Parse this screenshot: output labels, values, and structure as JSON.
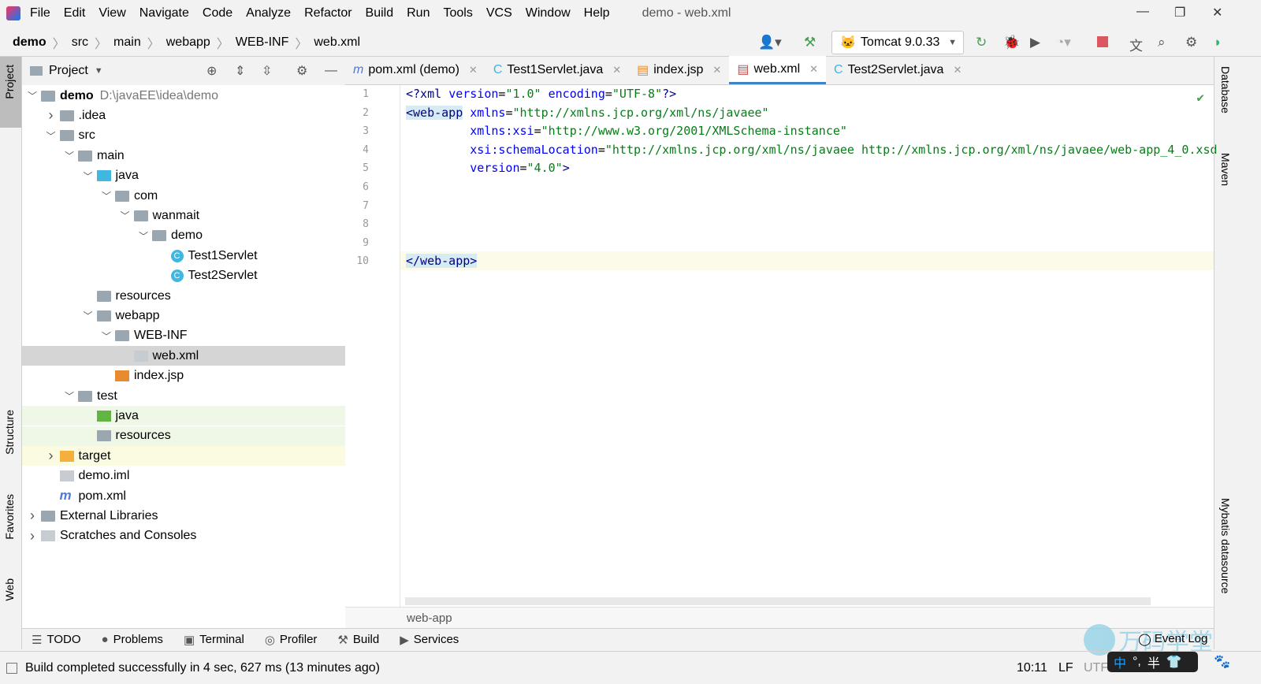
{
  "menu": {
    "items": [
      "File",
      "Edit",
      "View",
      "Navigate",
      "Code",
      "Analyze",
      "Refactor",
      "Build",
      "Run",
      "Tools",
      "VCS",
      "Window",
      "Help"
    ],
    "title": "demo - web.xml"
  },
  "breadcrumb": [
    "demo",
    "src",
    "main",
    "webapp",
    "WEB-INF",
    "web.xml"
  ],
  "toolbar": {
    "run_config": "Tomcat 9.0.33"
  },
  "left_strip": {
    "project": "Project",
    "structure": "Structure",
    "favorites": "Favorites",
    "web": "Web"
  },
  "right_strip": {
    "database": "Database",
    "maven": "Maven",
    "mybatis": "Mybatis datasource"
  },
  "project_panel": {
    "title": "Project",
    "tree": [
      {
        "label": "demo",
        "path": "D:\\javaEE\\idea\\demo",
        "depth": 0,
        "expanded": true,
        "icon": "module-folder"
      },
      {
        "label": ".idea",
        "depth": 1,
        "expanded": false,
        "icon": "folder"
      },
      {
        "label": "src",
        "depth": 1,
        "expanded": true,
        "icon": "folder"
      },
      {
        "label": "main",
        "depth": 2,
        "expanded": true,
        "icon": "folder"
      },
      {
        "label": "java",
        "depth": 3,
        "expanded": true,
        "icon": "source-folder"
      },
      {
        "label": "com",
        "depth": 4,
        "expanded": true,
        "icon": "package"
      },
      {
        "label": "wanmait",
        "depth": 5,
        "expanded": true,
        "icon": "package"
      },
      {
        "label": "demo",
        "depth": 6,
        "expanded": true,
        "icon": "package"
      },
      {
        "label": "Test1Servlet",
        "depth": 7,
        "icon": "class"
      },
      {
        "label": "Test2Servlet",
        "depth": 7,
        "icon": "class"
      },
      {
        "label": "resources",
        "depth": 3,
        "icon": "resources-folder"
      },
      {
        "label": "webapp",
        "depth": 3,
        "expanded": true,
        "icon": "web-folder"
      },
      {
        "label": "WEB-INF",
        "depth": 4,
        "expanded": true,
        "icon": "folder"
      },
      {
        "label": "web.xml",
        "depth": 5,
        "icon": "xml-file",
        "selected": true
      },
      {
        "label": "index.jsp",
        "depth": 4,
        "icon": "jsp-file"
      },
      {
        "label": "test",
        "depth": 2,
        "expanded": true,
        "icon": "folder"
      },
      {
        "label": "java",
        "depth": 3,
        "icon": "test-folder",
        "highlight": "green"
      },
      {
        "label": "resources",
        "depth": 3,
        "icon": "test-resources-folder",
        "highlight": "green"
      },
      {
        "label": "target",
        "depth": 1,
        "expanded": false,
        "icon": "excluded-folder",
        "highlight": "yellow"
      },
      {
        "label": "demo.iml",
        "depth": 1,
        "icon": "iml-file"
      },
      {
        "label": "pom.xml",
        "depth": 1,
        "icon": "maven-file"
      },
      {
        "label": "External Libraries",
        "depth": 0,
        "expanded": false,
        "icon": "libraries"
      },
      {
        "label": "Scratches and Consoles",
        "depth": 0,
        "expanded": false,
        "icon": "scratches"
      }
    ]
  },
  "tabs": [
    {
      "label": "pom.xml (demo)",
      "icon": "maven"
    },
    {
      "label": "Test1Servlet.java",
      "icon": "class"
    },
    {
      "label": "index.jsp",
      "icon": "jsp"
    },
    {
      "label": "web.xml",
      "icon": "xml",
      "active": true
    },
    {
      "label": "Test2Servlet.java",
      "icon": "class"
    }
  ],
  "editor": {
    "lines": [
      {
        "n": "1",
        "parts": [
          [
            "pi",
            "<?xml "
          ],
          [
            "attr",
            "version"
          ],
          [
            "",
            "="
          ],
          [
            "val",
            "\"1.0\""
          ],
          [
            "attr",
            " encoding"
          ],
          [
            "",
            "="
          ],
          [
            "val",
            "\"UTF-8\""
          ],
          [
            "pi",
            "?>"
          ]
        ]
      },
      {
        "n": "2",
        "parts": [
          [
            "tag",
            "<web-app"
          ],
          [
            "",
            " "
          ],
          [
            "attr",
            "xmlns"
          ],
          [
            "",
            "="
          ],
          [
            "val",
            "\"http://xmlns.jcp.org/xml/ns/javaee\""
          ]
        ]
      },
      {
        "n": "3",
        "parts": [
          [
            "",
            "         "
          ],
          [
            "attr",
            "xmlns:xsi"
          ],
          [
            "",
            "="
          ],
          [
            "val",
            "\"http://www.w3.org/2001/XMLSchema-instance\""
          ]
        ]
      },
      {
        "n": "4",
        "parts": [
          [
            "",
            "         "
          ],
          [
            "attr",
            "xsi:schemaLocation"
          ],
          [
            "",
            "="
          ],
          [
            "val",
            "\"http://xmlns.jcp.org/xml/ns/javaee http://xmlns.jcp.org/xml/ns/javaee/web-app_4_0.xsd"
          ]
        ]
      },
      {
        "n": "5",
        "parts": [
          [
            "",
            "         "
          ],
          [
            "attr",
            "version"
          ],
          [
            "",
            "="
          ],
          [
            "val",
            "\"4.0\""
          ],
          [
            "pi",
            ">"
          ]
        ]
      },
      {
        "n": "6",
        "parts": []
      },
      {
        "n": "7",
        "parts": []
      },
      {
        "n": "8",
        "parts": []
      },
      {
        "n": "9",
        "parts": []
      },
      {
        "n": "10",
        "parts": [
          [
            "tag",
            "</web-app>"
          ]
        ]
      }
    ],
    "breadcrumb": "web-app"
  },
  "tool_windows": [
    "TODO",
    "Problems",
    "Terminal",
    "Profiler",
    "Build",
    "Services"
  ],
  "event_log": "Event Log",
  "status": {
    "message": "Build completed successfully in 4 sec, 627 ms (13 minutes ago)",
    "position": "10:11",
    "line_sep": "LF",
    "encoding": "UTF"
  },
  "ime": {
    "mode": "中",
    "punct": "°,",
    "width": "半"
  },
  "watermark": "万码学堂"
}
